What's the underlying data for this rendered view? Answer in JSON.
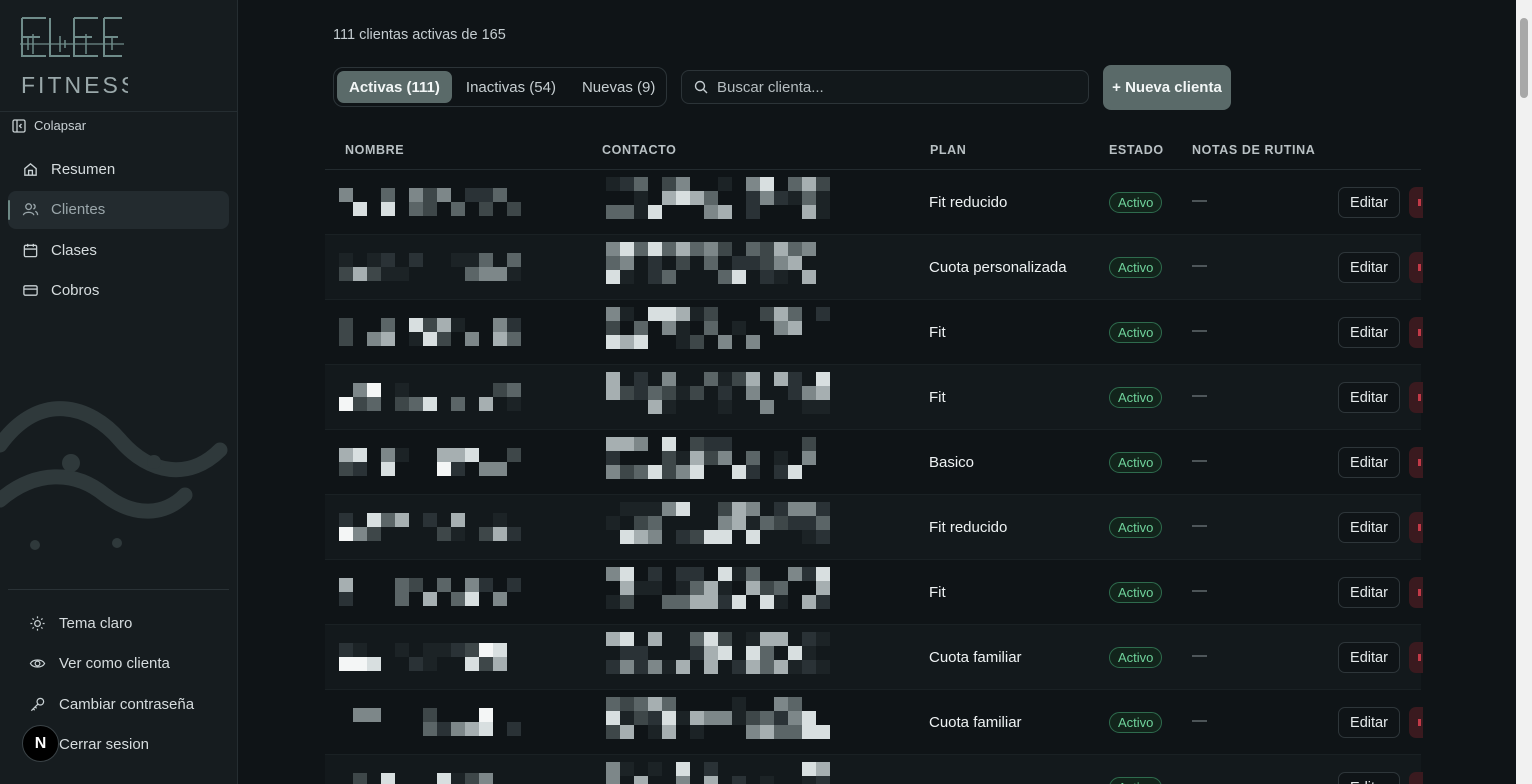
{
  "sidebar": {
    "collapse_label": "Colapsar",
    "nav": [
      {
        "label": "Resumen",
        "icon": "home-icon",
        "active": false
      },
      {
        "label": "Clientes",
        "icon": "users-icon",
        "active": true
      },
      {
        "label": "Clases",
        "icon": "calendar-icon",
        "active": false
      },
      {
        "label": "Cobros",
        "icon": "credit-card-icon",
        "active": false
      }
    ],
    "bottom": [
      {
        "label": "Tema claro",
        "icon": "sun-icon"
      },
      {
        "label": "Ver como clienta",
        "icon": "eye-icon"
      },
      {
        "label": "Cambiar contraseña",
        "icon": "key-icon"
      },
      {
        "label": "Cerrar sesion",
        "icon": "logout-icon"
      }
    ],
    "avatar_letter": "N"
  },
  "main": {
    "count_text": "111 clientas activas de 165",
    "tabs": [
      {
        "label": "Activas (111)",
        "active": true
      },
      {
        "label": "Inactivas (54)",
        "active": false
      },
      {
        "label": "Nuevas (9)",
        "active": false
      }
    ],
    "search_placeholder": "Buscar clienta...",
    "new_button": "+ Nueva clienta",
    "table": {
      "headers": {
        "name": "NOMBRE",
        "contact": "CONTACTO",
        "plan": "PLAN",
        "status": "ESTADO",
        "notes": "NOTAS DE RUTINA"
      },
      "rows": [
        {
          "plan": "Fit reducido",
          "status": "Activo",
          "notes": "—",
          "edit": "Editar"
        },
        {
          "plan": "Cuota personalizada",
          "status": "Activo",
          "notes": "—",
          "edit": "Editar"
        },
        {
          "plan": "Fit",
          "status": "Activo",
          "notes": "—",
          "edit": "Editar"
        },
        {
          "plan": "Fit",
          "status": "Activo",
          "notes": "—",
          "edit": "Editar"
        },
        {
          "plan": "Basico",
          "status": "Activo",
          "notes": "—",
          "edit": "Editar"
        },
        {
          "plan": "Fit reducido",
          "status": "Activo",
          "notes": "—",
          "edit": "Editar"
        },
        {
          "plan": "Fit",
          "status": "Activo",
          "notes": "—",
          "edit": "Editar"
        },
        {
          "plan": "Cuota familiar",
          "status": "Activo",
          "notes": "—",
          "edit": "Editar"
        },
        {
          "plan": "Cuota familiar",
          "status": "Activo",
          "notes": "—",
          "edit": "Editar"
        },
        {
          "plan": "",
          "status": "Activo",
          "notes": "—",
          "edit": "Editar"
        }
      ]
    }
  },
  "colors": {
    "accent": "#5a6a69",
    "active_badge": "#6fd39b",
    "danger": "#c23a48",
    "background": "#0f1417"
  }
}
